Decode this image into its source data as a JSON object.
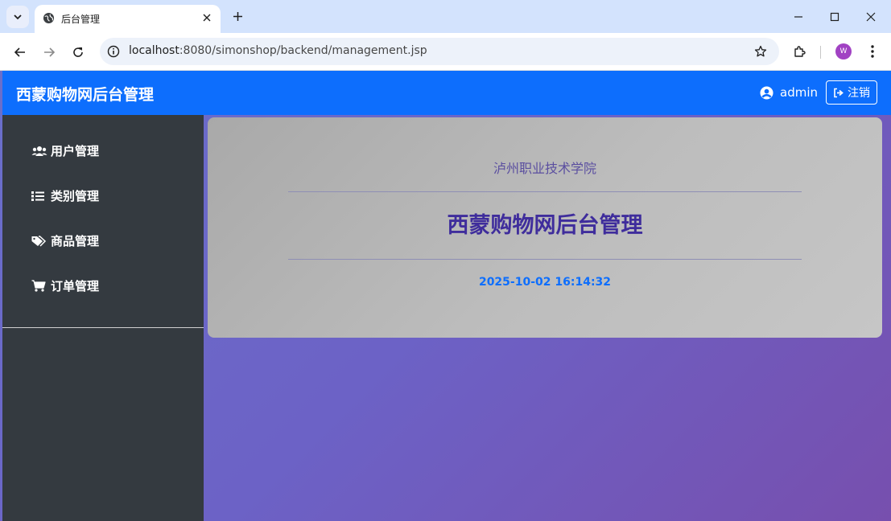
{
  "browser": {
    "tab_title": "后台管理",
    "url_host": "localhost",
    "url_rest": ":8080/simonshop/backend/management.jsp",
    "profile_initial": "W"
  },
  "navbar": {
    "brand": "西蒙购物网后台管理",
    "username": "admin",
    "logout_label": "注销"
  },
  "sidebar": {
    "items": [
      {
        "label": "用户管理",
        "icon": "users-icon"
      },
      {
        "label": "类别管理",
        "icon": "list-icon"
      },
      {
        "label": "商品管理",
        "icon": "tags-icon"
      },
      {
        "label": "订单管理",
        "icon": "cart-icon"
      }
    ]
  },
  "main": {
    "college": "泸州职业技术学院",
    "title": "西蒙购物网后台管理",
    "datetime": "2025-10-02 16:14:32"
  },
  "colors": {
    "navbar": "#0d6efd",
    "sidebar": "#343a40",
    "title": "#3f2d9c",
    "datetime": "#0d6efd"
  }
}
